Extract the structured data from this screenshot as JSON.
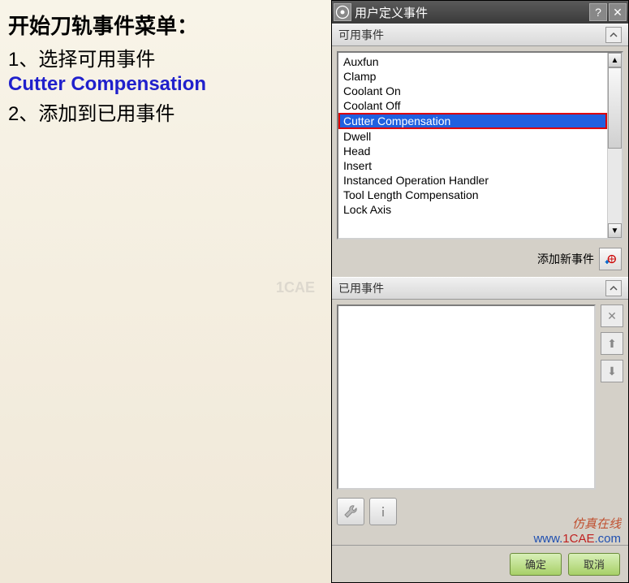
{
  "left": {
    "title": "开始刀轨事件菜单：",
    "step1": "1、选择可用事件",
    "highlight": "Cutter Compensation",
    "step2": "2、添加到已用事件"
  },
  "dialog": {
    "title": "用户定义事件",
    "sections": {
      "available": "可用事件",
      "used": "已用事件"
    },
    "events": [
      "Auxfun",
      "Clamp",
      "Coolant On",
      "Coolant Off",
      "Cutter Compensation",
      "Dwell",
      "Head",
      "Insert",
      "Instanced Operation Handler",
      "Tool Length Compensation",
      "Lock Axis"
    ],
    "selected_index": 4,
    "add_label": "添加新事件",
    "footer": {
      "ok": "确定",
      "cancel": "取消"
    }
  },
  "watermark": {
    "center": "1CAE",
    "br_zh": "仿真在线",
    "br_url_1": "www.",
    "br_url_2": "1CAE",
    "br_url_3": ".com"
  }
}
